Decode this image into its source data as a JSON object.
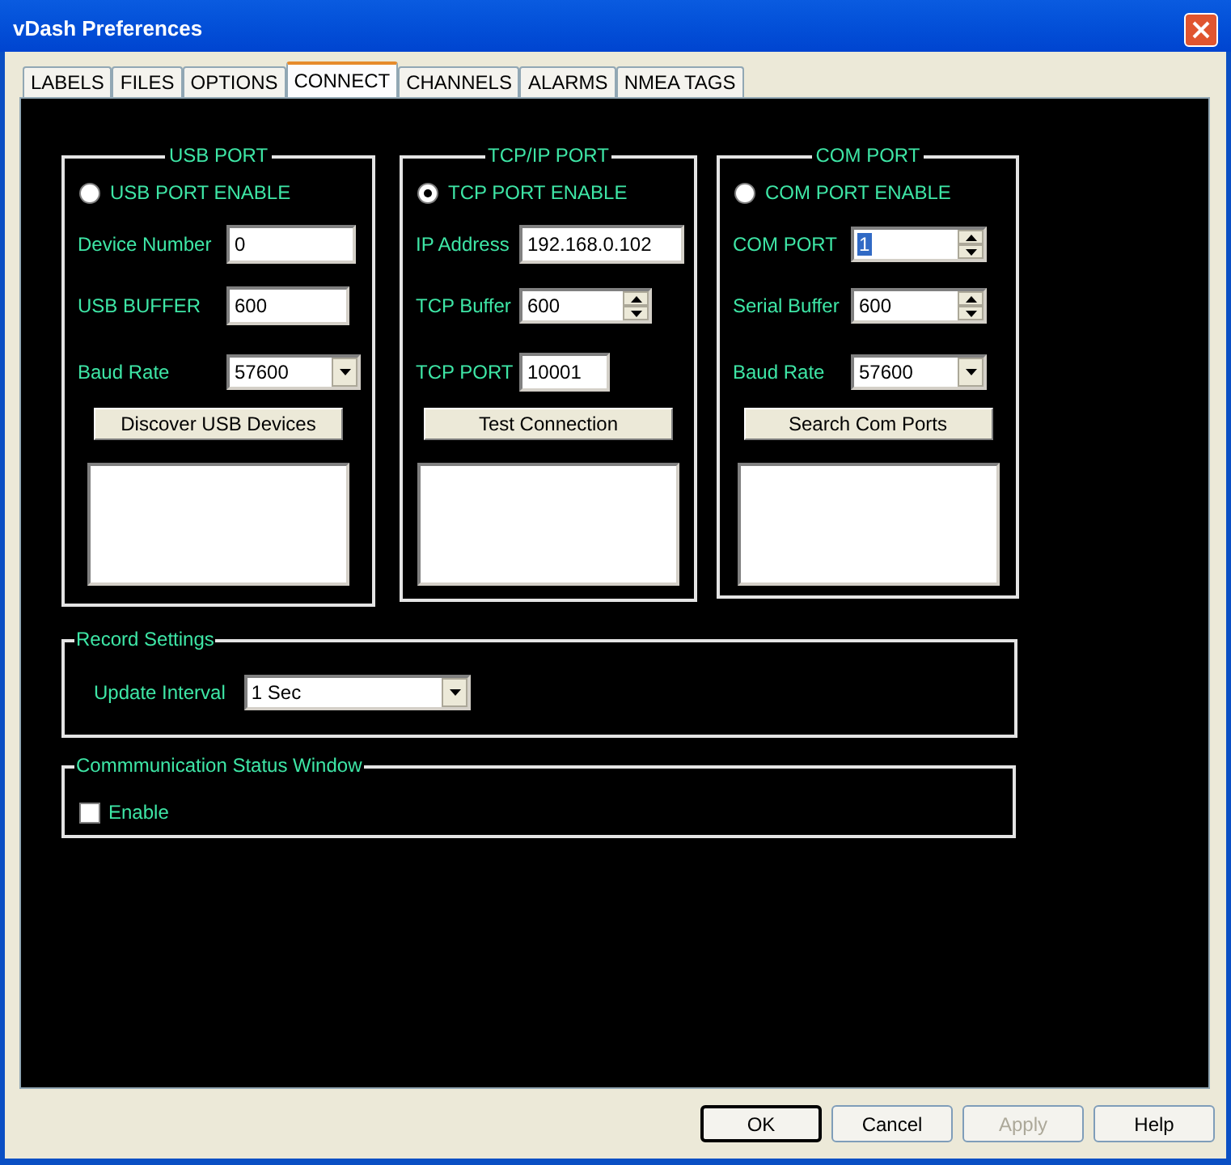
{
  "window": {
    "title": "vDash Preferences"
  },
  "tabs": [
    {
      "label": "LABELS",
      "selected": false
    },
    {
      "label": "FILES",
      "selected": false
    },
    {
      "label": "OPTIONS",
      "selected": false
    },
    {
      "label": "CONNECT",
      "selected": true
    },
    {
      "label": "CHANNELS",
      "selected": false
    },
    {
      "label": "ALARMS",
      "selected": false
    },
    {
      "label": "NMEA TAGS",
      "selected": false
    }
  ],
  "port_groups": [
    {
      "title": "USB PORT",
      "enable": {
        "label": "USB PORT ENABLE",
        "selected": false
      },
      "fields": [
        {
          "kind": "text",
          "label": "Device Number",
          "value": "0",
          "focused": false
        },
        {
          "kind": "text",
          "label": "USB BUFFER",
          "value": "600",
          "focused": false
        },
        {
          "kind": "combo",
          "label": "Baud Rate",
          "value": "57600",
          "focused": false
        }
      ],
      "button": "Discover USB Devices"
    },
    {
      "title": "TCP/IP PORT",
      "enable": {
        "label": "TCP PORT ENABLE",
        "selected": true
      },
      "fields": [
        {
          "kind": "text",
          "label": "IP Address",
          "value": "192.168.0.102",
          "focused": false
        },
        {
          "kind": "spin",
          "label": "TCP Buffer",
          "value": "600",
          "focused": false
        },
        {
          "kind": "text",
          "label": "TCP PORT",
          "value": "10001",
          "focused": false
        }
      ],
      "button": "Test Connection"
    },
    {
      "title": "COM PORT",
      "enable": {
        "label": "COM PORT ENABLE",
        "selected": false
      },
      "fields": [
        {
          "kind": "spin",
          "label": "COM PORT",
          "value": "1",
          "focused": true
        },
        {
          "kind": "spin",
          "label": "Serial Buffer",
          "value": "600",
          "focused": false
        },
        {
          "kind": "combo",
          "label": "Baud Rate",
          "value": "57600",
          "focused": false
        }
      ],
      "button": "Search Com Ports"
    }
  ],
  "record_settings": {
    "title": "Record Settings",
    "update_interval": {
      "label": "Update Interval",
      "value": "1 Sec"
    }
  },
  "communication_status": {
    "title": "Commmunication Status Window",
    "enable": {
      "label": "Enable",
      "checked": false
    }
  },
  "buttons": [
    {
      "label": "OK",
      "default": true,
      "disabled": false
    },
    {
      "label": "Cancel",
      "default": false,
      "disabled": false
    },
    {
      "label": "Apply",
      "default": false,
      "disabled": true
    },
    {
      "label": "Help",
      "default": false,
      "disabled": false
    }
  ]
}
